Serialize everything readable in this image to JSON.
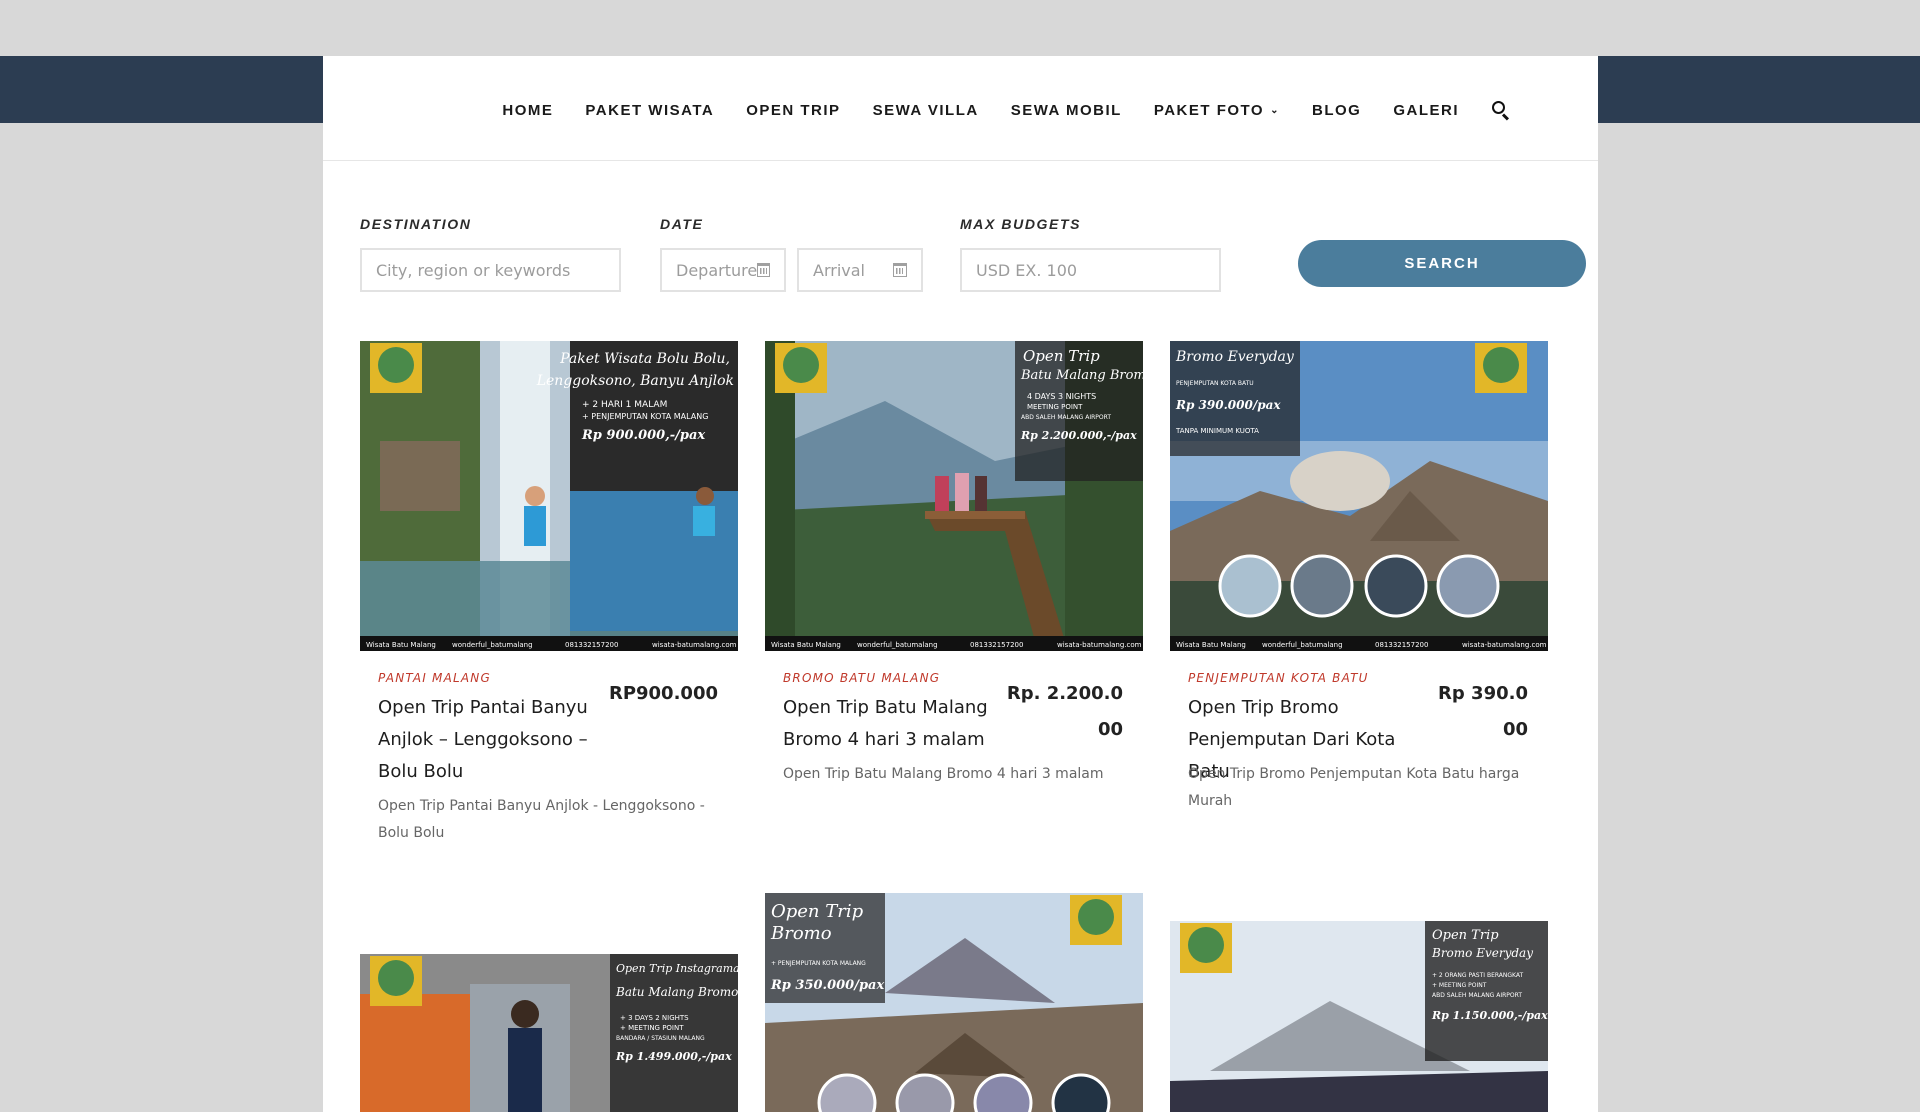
{
  "nav": {
    "items": [
      "HOME",
      "PAKET WISATA",
      "OPEN TRIP",
      "SEWA VILLA",
      "SEWA MOBIL",
      "PAKET FOTO",
      "BLOG",
      "GALERI"
    ],
    "dropdown_item": "PAKET FOTO"
  },
  "search": {
    "destination_label": "DESTINATION",
    "destination_placeholder": "City, region or keywords",
    "date_label": "DATE",
    "departure_placeholder": "Departure",
    "arrival_placeholder": "Arrival",
    "budget_label": "MAX BUDGETS",
    "budget_placeholder": "USD EX. 100",
    "button": "SEARCH"
  },
  "cards": [
    {
      "category": "PANTAI MALANG",
      "title": "Open Trip Pantai Banyu Anjlok – Lenggoksono – Bolu Bolu",
      "price": "RP900.000",
      "description": "Open Trip Pantai Banyu Anjlok - Lenggoksono - Bolu Bolu",
      "image_text": [
        "Paket Wisata Bolu Bolu,",
        "Lenggoksono, Banyu Anjlok",
        "+ 2 HARI 1 MALAM",
        "+ PENJEMPUTAN KOTA MALANG",
        "Rp 900.000,-/pax"
      ]
    },
    {
      "category": "BROMO BATU MALANG",
      "title": "Open Trip Batu Malang Bromo 4 hari 3 malam",
      "price": "Rp. 2.200.000",
      "description": "Open Trip Batu Malang Bromo 4 hari 3 malam",
      "image_text": [
        "Open Trip",
        "Batu Malang Bromo",
        "4 DAYS 3 NIGHTS",
        "MEETING POINT",
        "ABD SALEH MALANG AIRPORT",
        "Rp 2.200.000,-/pax"
      ]
    },
    {
      "category": "PENJEMPUTAN KOTA BATU",
      "title": "Open Trip Bromo Penjemputan Dari Kota Batu",
      "price": "Rp 390.000",
      "description": "Open Trip Bromo Penjemputan Kota Batu harga Murah",
      "image_text": [
        "Bromo Everyday",
        "PENJEMPUTAN KOTA BATU",
        "Rp 390.000/pax",
        "TANPA MINIMUM KUOTA"
      ]
    }
  ],
  "bottom_cards": [
    {
      "image_text": [
        "Open Trip Instagramable",
        "Batu Malang Bromo",
        "+ 3 DAYS 2 NIGHTS",
        "+ MEETING POINT",
        "BANDARA / STASIUN MALANG",
        "Rp 1.499.000,-/pax"
      ]
    },
    {
      "image_text": [
        "Open Trip",
        "Bromo",
        "+ PENJEMPUTAN KOTA MALANG",
        "Rp 350.000/pax"
      ]
    },
    {
      "image_text": [
        "Open Trip",
        "Bromo Everyday",
        "+ 2 ORANG PASTI BERANGKAT",
        "+ MEETING POINT",
        "ABD SALEH MALANG AIRPORT",
        "Rp 1.150.000,-/pax"
      ]
    }
  ],
  "image_footer": [
    "Wisata Batu Malang",
    "wonderful_batumalang",
    "081332157200",
    "wisata-batumalang.com"
  ],
  "colors": {
    "header_dark": "#2c3d52",
    "accent": "#4b7d9c",
    "category_red": "#c0392b"
  }
}
